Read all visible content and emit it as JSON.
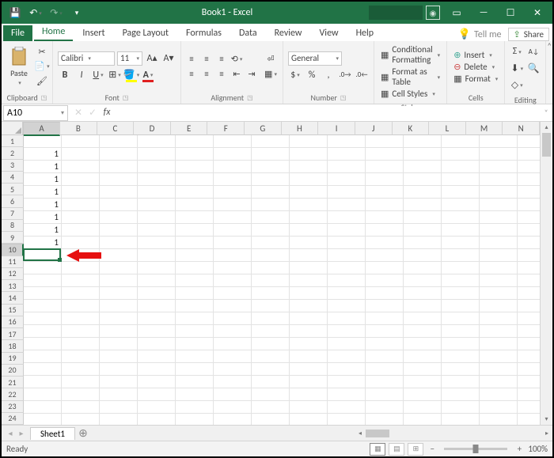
{
  "title": "Book1 - Excel",
  "tabs": {
    "file": "File",
    "home": "Home",
    "insert": "Insert",
    "page_layout": "Page Layout",
    "formulas": "Formulas",
    "data": "Data",
    "review": "Review",
    "view": "View",
    "help": "Help",
    "tellme": "Tell me",
    "share": "Share"
  },
  "ribbon": {
    "clipboard": {
      "label": "Clipboard",
      "paste": "Paste"
    },
    "font": {
      "label": "Font",
      "name": "Calibri",
      "size": "11"
    },
    "alignment": {
      "label": "Alignment"
    },
    "number": {
      "label": "Number",
      "format": "General"
    },
    "styles": {
      "label": "Styles",
      "cond": "Conditional Formatting",
      "table": "Format as Table",
      "cell": "Cell Styles"
    },
    "cells": {
      "label": "Cells",
      "insert": "Insert",
      "delete": "Delete",
      "format": "Format"
    },
    "editing": {
      "label": "Editing"
    }
  },
  "namebox": "A10",
  "columns": [
    "A",
    "B",
    "C",
    "D",
    "E",
    "F",
    "G",
    "H",
    "I",
    "J",
    "K",
    "L",
    "M",
    "N"
  ],
  "rows_count": 24,
  "active": {
    "row": 10,
    "col": 1
  },
  "cells": {
    "A2": "1",
    "A3": "1",
    "A4": "1",
    "A5": "1",
    "A6": "1",
    "A7": "1",
    "A8": "1",
    "A9": "1"
  },
  "sheet": {
    "name": "Sheet1"
  },
  "status": {
    "ready": "Ready",
    "zoom": "100%"
  }
}
